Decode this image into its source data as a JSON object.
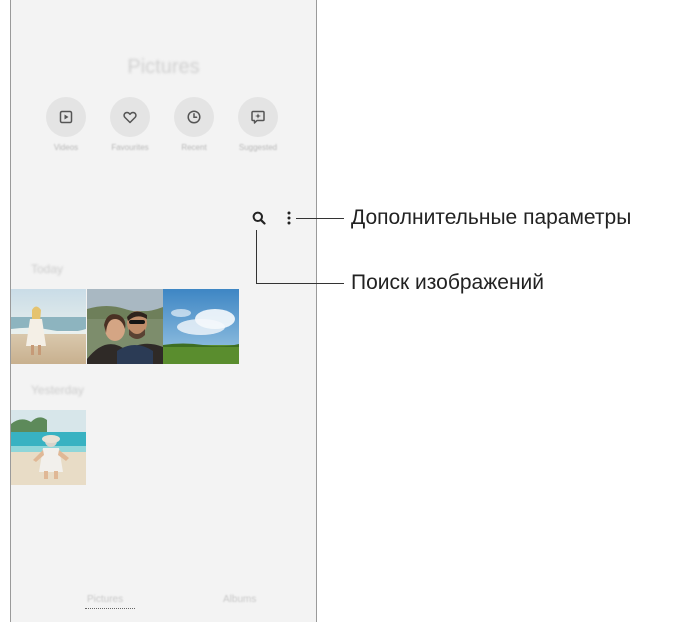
{
  "app": {
    "title": "Pictures"
  },
  "quick_actions": [
    {
      "label": "Videos",
      "icon": "play-icon"
    },
    {
      "label": "Favourites",
      "icon": "heart-icon"
    },
    {
      "label": "Recent",
      "icon": "clock-icon"
    },
    {
      "label": "Suggested",
      "icon": "suggested-icon"
    }
  ],
  "toolbar": {
    "search_icon": "search-icon",
    "more_icon": "more-options-icon"
  },
  "sections": {
    "today": "Today",
    "yesterday": "Yesterday"
  },
  "bottom_nav": {
    "pictures": "Pictures",
    "albums": "Albums"
  },
  "callouts": {
    "more_options": "Дополнительные параметры",
    "search": "Поиск изображений"
  }
}
